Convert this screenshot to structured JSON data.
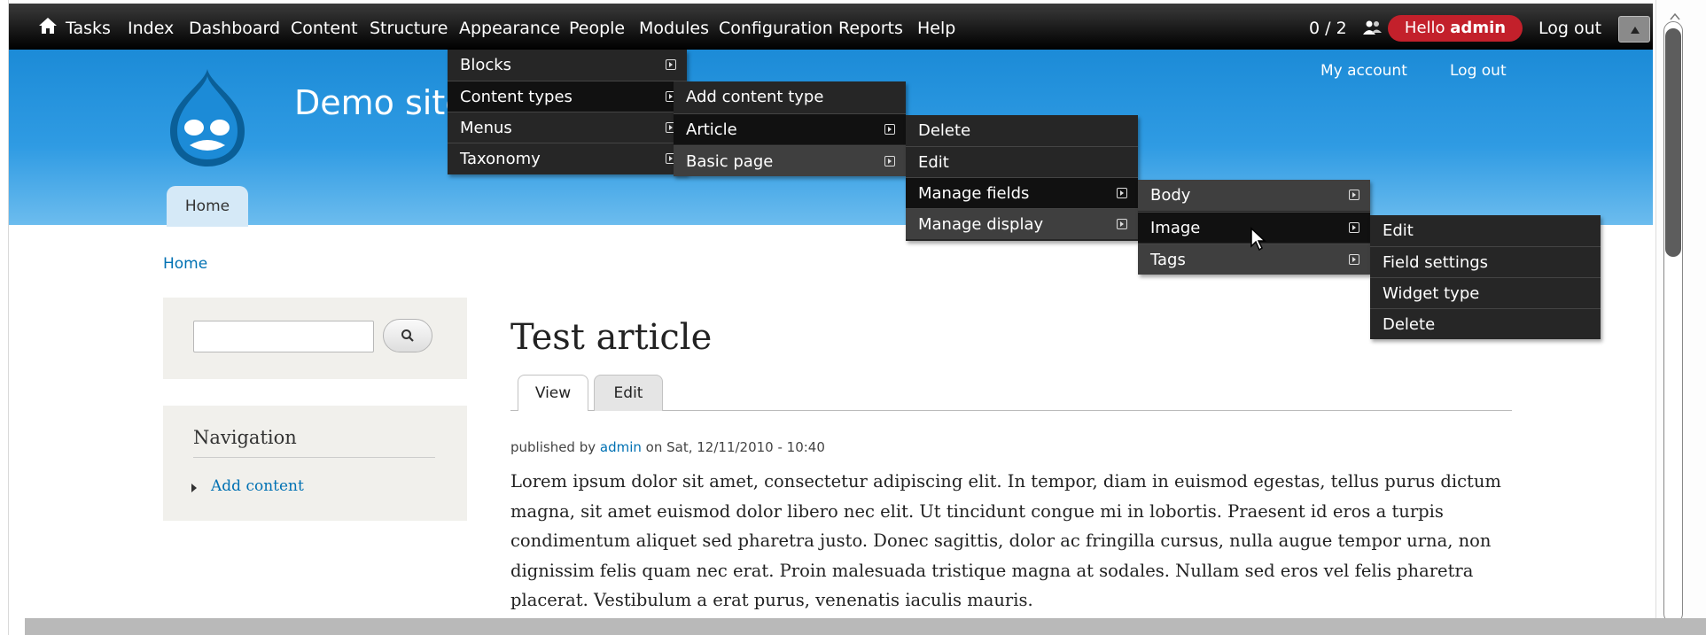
{
  "toolbar": {
    "items": [
      "Tasks",
      "Index",
      "Dashboard",
      "Content",
      "Structure",
      "Appearance",
      "People",
      "Modules",
      "Configuration",
      "Reports",
      "Help"
    ],
    "counter": "0 / 2",
    "hello_prefix": "Hello ",
    "hello_user": "admin",
    "logout": "Log out",
    "home_icon": "home-icon",
    "users_icon": "users-icon",
    "toggle_icon": "toggle-arrow-icon"
  },
  "header": {
    "site_name": "Demo site",
    "secondary_menu": [
      "My account",
      "Log out"
    ],
    "main_tab": "Home",
    "colors": {
      "header_top": "#1c8bd7",
      "header_bottom": "#6cbcee"
    }
  },
  "breadcrumb": "Home",
  "search": {
    "value": "",
    "button_icon": "search-icon"
  },
  "navigation": {
    "title": "Navigation",
    "link": "Add content"
  },
  "article": {
    "title": "Test article",
    "tabs": [
      "View",
      "Edit"
    ],
    "submitted_prefix": "published by ",
    "author": "admin",
    "submitted_suffix": " on Sat, 12/11/2010 - 10:40",
    "body": "Lorem ipsum dolor sit amet, consectetur adipiscing elit. In tempor, diam in euismod egestas, tellus purus dictum magna, sit amet euismod dolor libero nec elit. Ut tincidunt congue mi in lobortis. Praesent id eros a turpis condimentum aliquet sed pharetra justo. Donec sagittis, dolor ac fringilla cursus, nulla augue tempor urna, non dignissim felis quam nec erat. Proin malesuada tristique magna at sodales. Nullam sed eros vel felis pharetra placerat. Vestibulum a erat purus, venenatis iaculis mauris."
  },
  "menus": {
    "structure": [
      "Blocks",
      "Content types",
      "Menus",
      "Taxonomy"
    ],
    "content_types": [
      "Add content type",
      "Article",
      "Basic page"
    ],
    "article": [
      "Delete",
      "Edit",
      "Manage fields",
      "Manage display"
    ],
    "fields": [
      "Body",
      "Image",
      "Tags"
    ],
    "image": [
      "Edit",
      "Field settings",
      "Widget type",
      "Delete"
    ]
  },
  "colors": {
    "menu_bg": "#262626",
    "accent_red": "#c3202b",
    "link": "#0071b3"
  }
}
